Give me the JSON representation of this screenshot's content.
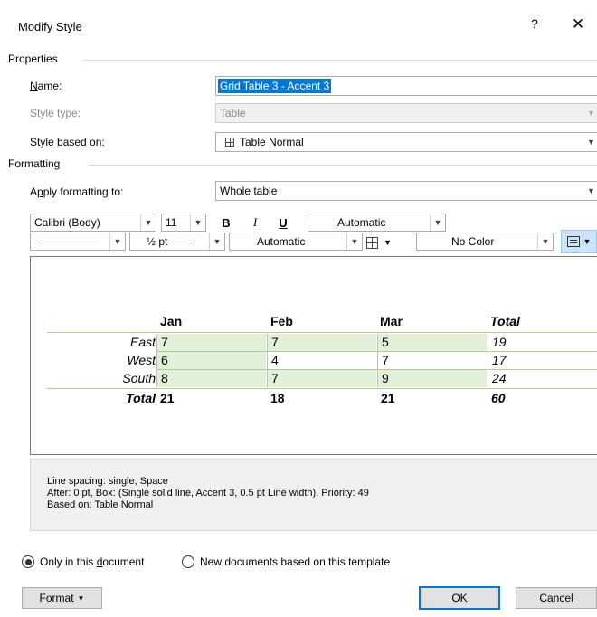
{
  "dialog": {
    "title": "Modify Style",
    "help_glyph": "?",
    "close_glyph": "✕"
  },
  "properties": {
    "section": "Properties",
    "name_label_pre": "",
    "name_label_u": "N",
    "name_label_post": "ame:",
    "name_value": "Grid Table 3 - Accent 3",
    "style_type_label": "Style type:",
    "style_type_value": "Table",
    "based_on_label_pre": "Style ",
    "based_on_label_u": "b",
    "based_on_label_post": "ased on:",
    "based_on_value": "Table Normal"
  },
  "formatting": {
    "section": "Formatting",
    "apply_label_pre": "A",
    "apply_label_u": "p",
    "apply_label_post": "ply formatting to:",
    "apply_value": "Whole table",
    "font": "Calibri (Body)",
    "size": "11",
    "bold": "B",
    "italic": "I",
    "underline": "U",
    "font_color": "Automatic",
    "border_width": "½ pt",
    "border_color": "Automatic",
    "shading": "No Color"
  },
  "preview": {
    "headers": [
      "Jan",
      "Feb",
      "Mar",
      "Total"
    ],
    "rows": [
      {
        "label": "East",
        "values": [
          "7",
          "7",
          "5",
          "19"
        ]
      },
      {
        "label": "West",
        "values": [
          "6",
          "4",
          "7",
          "17"
        ]
      },
      {
        "label": "South",
        "values": [
          "8",
          "7",
          "9",
          "24"
        ]
      },
      {
        "label": "Total",
        "values": [
          "21",
          "18",
          "21",
          "60"
        ]
      }
    ]
  },
  "description": {
    "line1": "Line spacing:  single, Space",
    "line2": "After:  0 pt, Box: (Single solid line, Accent 3,  0.5 pt Line width), Priority: 49",
    "line3": "Based on: Table Normal"
  },
  "scope": {
    "this_doc_pre": "Only in this ",
    "this_doc_u": "d",
    "this_doc_post": "ocument",
    "new_docs": "New documents based on this template"
  },
  "buttons": {
    "format_pre": "F",
    "format_u": "o",
    "format_post": "rmat",
    "ok": "OK",
    "cancel": "Cancel"
  },
  "colors": {
    "accent": "#0078d7",
    "table_band": "#e2efd9",
    "table_line": "#a9d08e"
  }
}
